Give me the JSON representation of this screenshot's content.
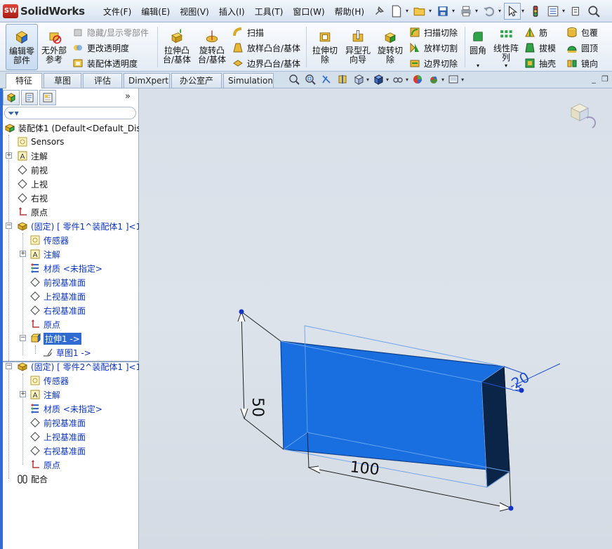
{
  "app": {
    "logo_badge": "SW",
    "logo_text": "SolidWorks"
  },
  "menus": [
    "文件(F)",
    "编辑(E)",
    "视图(V)",
    "插入(I)",
    "工具(T)",
    "窗口(W)",
    "帮助(H)"
  ],
  "ribbon": {
    "edit_component": "编辑零部件",
    "no_external_refs": "无外部参考",
    "hide_show": "隐藏/显示零部件",
    "change_transparency": "更改透明度",
    "assembly_transparency": "装配体透明度",
    "extrude_boss": "拉伸凸台/基体",
    "revolve_boss": "旋转凸台/基体",
    "sweep": "扫描",
    "loft_boss": "放样凸台/基体",
    "boundary_boss": "边界凸台/基体",
    "extrude_cut": "拉伸切除",
    "hole_wizard": "异型孔向导",
    "revolve_cut": "旋转切除",
    "sweep_cut": "扫描切除",
    "loft_cut": "放样切割",
    "boundary_cut": "边界切除",
    "fillet": "圆角",
    "linear_pattern": "线性阵列",
    "rib": "筋",
    "draft": "拔模",
    "shell": "抽壳",
    "wrap": "包覆",
    "dome": "圆顶",
    "mirror": "镜向"
  },
  "tabs": [
    "特征",
    "草图",
    "评估",
    "DimXpert",
    "办公室产品",
    "Simulation"
  ],
  "tree": {
    "root": "装配体1 (Default<Default_Dis",
    "sensors": "Sensors",
    "annotations": "注解",
    "front": "前视",
    "top": "上视",
    "right": "右视",
    "origin": "原点",
    "part1": "(固定) [ 零件1^装配体1 ]<1",
    "p1_sensors": "传感器",
    "p1_annotations": "注解",
    "p1_material": "材质 <未指定>",
    "p1_front_plane": "前视基准面",
    "p1_top_plane": "上视基准面",
    "p1_right_plane": "右视基准面",
    "p1_origin": "原点",
    "p1_extrude": "拉伸1 ->",
    "p1_sketch": "草图1 ->",
    "part2": "(固定) [ 零件2^装配体1 ]<1",
    "p2_sensors": "传感器",
    "p2_annotations": "注解",
    "p2_material": "材质 <未指定>",
    "p2_front_plane": "前视基准面",
    "p2_top_plane": "上视基准面",
    "p2_right_plane": "右视基准面",
    "p2_origin": "原点",
    "mates": "配合"
  },
  "dimensions": {
    "height": "50",
    "width": "100",
    "depth": "20"
  },
  "colors": {
    "body": "#1a6fe0",
    "body_dark": "#0a2548",
    "accent": "#2f6bd1",
    "tree_blue": "#0b34c4"
  }
}
